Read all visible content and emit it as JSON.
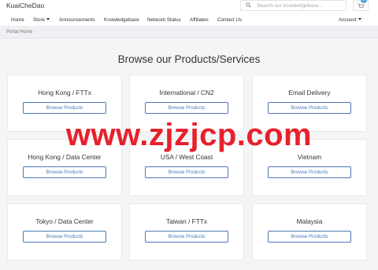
{
  "brand": "KuaiCheDao",
  "search": {
    "placeholder": "Search our knowledgebase..."
  },
  "cart": {
    "count": "0"
  },
  "nav": {
    "home": "Home",
    "store": "Store",
    "announcements": "Announcements",
    "knowledgebase": "Knowledgebase",
    "network_status": "Network Status",
    "affiliates": "Affiliates",
    "contact": "Contact Us",
    "account": "Account"
  },
  "breadcrumb": "Portal Home",
  "heading": "Browse our Products/Services",
  "products": [
    {
      "title": "Hong Kong / FTTx",
      "button": "Browse Products"
    },
    {
      "title": "International / CN2",
      "button": "Browse Products"
    },
    {
      "title": "Email Delivery",
      "button": "Browse Products"
    },
    {
      "title": "Hong Kong / Data Center",
      "button": "Browse Products"
    },
    {
      "title": "USA / West Coast",
      "button": "Browse Products"
    },
    {
      "title": "Vietnam",
      "button": "Browse Products"
    },
    {
      "title": "Tokyo / Data Center",
      "button": "Browse Products"
    },
    {
      "title": "Taiwan / FTTx",
      "button": "Browse Products"
    },
    {
      "title": "Malaysia",
      "button": "Browse Products"
    }
  ],
  "watermark": "www.zjzjcp.com"
}
